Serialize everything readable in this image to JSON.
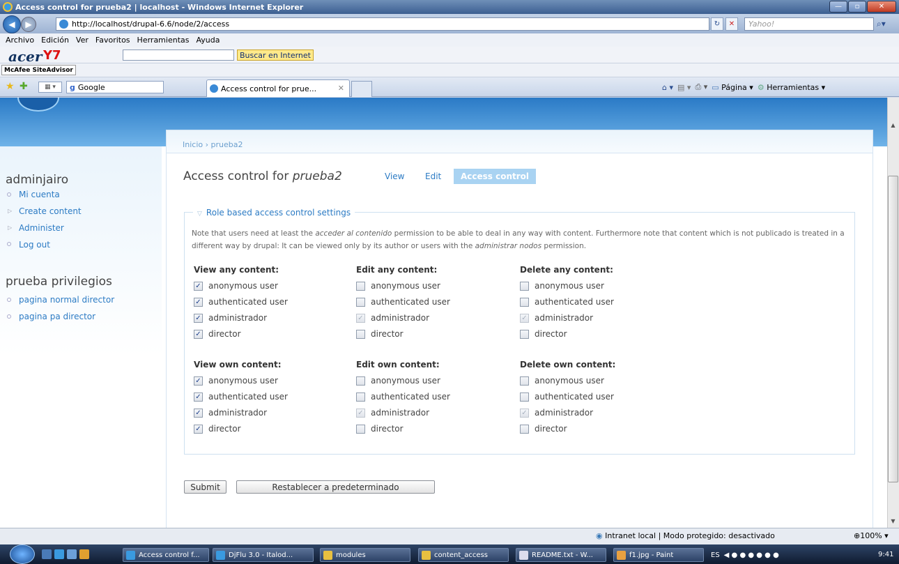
{
  "window": {
    "title": "Access control for prueba2 | localhost - Windows Internet Explorer",
    "url": "http://localhost/drupal-6.6/node/2/access",
    "search_placeholder": "Yahoo!"
  },
  "menu": [
    "Archivo",
    "Edición",
    "Ver",
    "Favoritos",
    "Herramientas",
    "Ayuda"
  ],
  "toolbar": {
    "acer": "acer",
    "y7": "Y7",
    "buscar": "Buscar en Internet",
    "mcafee": "McAfee SiteAdvisor",
    "google": "Google",
    "tab_title": "Access control for prue...",
    "pagina": "Página",
    "herramientas": "Herramientas"
  },
  "sidebar": {
    "user_block_title": "adminjairo",
    "user_links": [
      "Mi cuenta",
      "Create content",
      "Administer",
      "Log out"
    ],
    "block2_title": "prueba privilegios",
    "block2_links": [
      "pagina normal director",
      "pagina pa director"
    ]
  },
  "page": {
    "breadcrumb": "Inicio › prueba2",
    "title_prefix": "Access control for ",
    "title_node": "prueba2",
    "tabs": [
      "View",
      "Edit",
      "Access control"
    ],
    "fieldset_legend": "Role based access control settings",
    "desc_1": "Note that users need at least the ",
    "desc_perm1": "acceder al contenido",
    "desc_2": " permission to be able to deal in any way with content. Furthermore note that content which is not publicado is treated in a different way by drupal: It can be viewed only by its author or users with the ",
    "desc_perm2": "administrar nodos",
    "desc_3": " permission.",
    "roles": [
      "anonymous user",
      "authenticated user",
      "administrador",
      "director"
    ],
    "groups": [
      {
        "title": "View any content:",
        "checked": [
          true,
          true,
          true,
          true
        ],
        "disabled": [
          false,
          false,
          false,
          false
        ]
      },
      {
        "title": "Edit any content:",
        "checked": [
          false,
          false,
          true,
          false
        ],
        "disabled": [
          false,
          false,
          true,
          false
        ]
      },
      {
        "title": "Delete any content:",
        "checked": [
          false,
          false,
          true,
          false
        ],
        "disabled": [
          false,
          false,
          true,
          false
        ]
      },
      {
        "title": "View own content:",
        "checked": [
          true,
          true,
          true,
          true
        ],
        "disabled": [
          false,
          false,
          false,
          false
        ]
      },
      {
        "title": "Edit own content:",
        "checked": [
          false,
          false,
          true,
          false
        ],
        "disabled": [
          false,
          false,
          true,
          false
        ]
      },
      {
        "title": "Delete own content:",
        "checked": [
          false,
          false,
          true,
          false
        ],
        "disabled": [
          false,
          false,
          true,
          false
        ]
      }
    ],
    "submit_label": "Submit",
    "reset_label": "Restablecer a predeterminado"
  },
  "statusbar": {
    "zone": "Intranet local | Modo protegido: desactivado",
    "zoom": "100%"
  },
  "taskbar": {
    "items": [
      "Access control f...",
      "DjFlu 3.0 - Italod...",
      "modules",
      "content_access",
      "README.txt - W...",
      "f1.jpg - Paint"
    ],
    "lang": "ES",
    "clock": "9:41"
  }
}
